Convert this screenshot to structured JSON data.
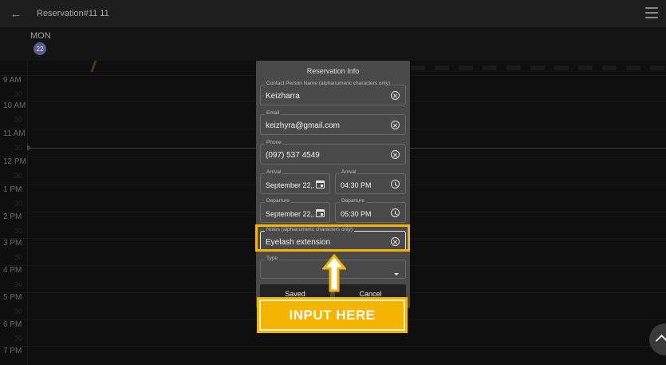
{
  "header": {
    "title": "Reservation#11 11"
  },
  "day": {
    "name": "MON",
    "number": "22"
  },
  "timeline": {
    "hours": [
      "9 AM",
      "10 AM",
      "11 AM",
      "12 PM",
      "1 PM",
      "2 PM",
      "3 PM",
      "4 PM",
      "5 PM",
      "6 PM",
      "7 PM"
    ],
    "half_label": "30"
  },
  "modal": {
    "title": "Reservation Info",
    "contact": {
      "label": "Contact Person Name (alphanumeric characters only)",
      "value": "Keizharra"
    },
    "email": {
      "label": "Email",
      "value": "keizhyra@gmail.com"
    },
    "phone": {
      "label": "Phone",
      "value": "(097) 537 4549"
    },
    "arrival_date": {
      "label": "Arrival",
      "value": "September 22,..."
    },
    "arrival_time": {
      "label": "Arrival",
      "value": "04:30 PM"
    },
    "departure_date": {
      "label": "Departure",
      "value": "September 22,..."
    },
    "departure_time": {
      "label": "Departure",
      "value": "05:30 PM"
    },
    "notes": {
      "label": "Notes (alphanumeric characters only)",
      "value": "Eyelash extension"
    },
    "type": {
      "label": "Type",
      "value": ""
    },
    "save_label": "Saved",
    "cancel_label": "Cancel"
  },
  "annotation": {
    "callout_text": "INPUT HERE",
    "color": "#f4b400"
  },
  "icons": {
    "back": "arrow-left-icon",
    "menu": "hamburger-menu-icon",
    "clear": "clear-circle-icon",
    "calendar": "calendar-icon",
    "clock": "clock-icon",
    "dropdown": "dropdown-arrow-icon",
    "fab": "chevron-up-icon"
  }
}
